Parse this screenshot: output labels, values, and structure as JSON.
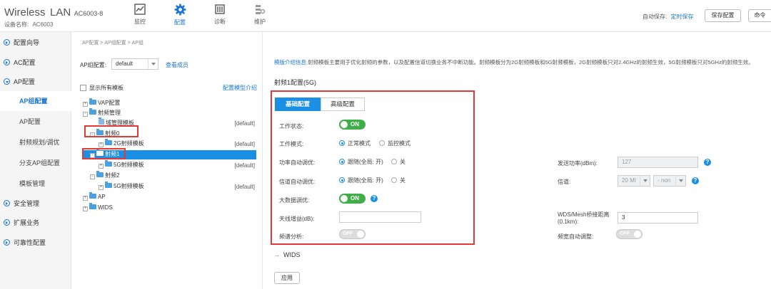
{
  "header": {
    "brand_wireless": "Wireless",
    "brand_lan": "LAN",
    "model": "AC6003-8",
    "device_label": "设备名称:",
    "device_name": "AC6003",
    "nav": [
      {
        "label": "监控",
        "icon": "monitor-chart-icon",
        "active": false
      },
      {
        "label": "配置",
        "icon": "gear-icon",
        "active": true
      },
      {
        "label": "诊断",
        "icon": "diagnose-tool-icon",
        "active": false
      },
      {
        "label": "维护",
        "icon": "maintenance-icon",
        "active": false
      }
    ],
    "autosave_label": "自动保存:",
    "autosave_link": "定时保存",
    "save_button": "保存配置",
    "cmd_button": "命令"
  },
  "sidebar": {
    "items": [
      {
        "label": "配置向导"
      },
      {
        "label": "AC配置"
      },
      {
        "label": "AP配置"
      }
    ],
    "subitems": [
      {
        "label": "AP组配置",
        "active": true
      },
      {
        "label": "AP配置",
        "active": false
      },
      {
        "label": "射频规划/调优",
        "active": false
      },
      {
        "label": "分支AP组配置",
        "active": false
      },
      {
        "label": "模板管理",
        "active": false
      }
    ],
    "bottom_items": [
      {
        "label": "安全管理"
      },
      {
        "label": "扩展业务"
      },
      {
        "label": "可靠性配置"
      }
    ]
  },
  "tree_panel": {
    "breadcrumb": "AP配置 > AP组配置 > AP组",
    "ap_group_label": "AP组配置:",
    "ap_group_value": "default",
    "view_members": "查看成员",
    "show_all_label": "显示所有模板",
    "model_intro": "配置模型介绍",
    "nodes": [
      {
        "label": "VAP配置",
        "pm": "+"
      },
      {
        "label": "射频管理",
        "pm": "-"
      },
      {
        "label": "域管理模板",
        "default": "[default]"
      },
      {
        "label": "射频0",
        "pm": "-"
      },
      {
        "label": "2G射频模板",
        "pm": "+",
        "default": "[default]"
      },
      {
        "label": "射频1",
        "pm": "-"
      },
      {
        "label": "5G射频模板",
        "pm": "+",
        "default": "[default]"
      },
      {
        "label": "射频2",
        "pm": "-"
      },
      {
        "label": "5G射频模板",
        "pm": "+",
        "default": "[default]"
      },
      {
        "label": "AP",
        "pm": "+"
      },
      {
        "label": "WIDS",
        "pm": "+"
      }
    ]
  },
  "main": {
    "info_key": "模版介绍信息:",
    "info_text": "射频模板主要用于优化射频的参数，以及配置信道切换业务不中断功能。射频模板分为2G射频模板和5G射频模板，2G射频模板只对2.4GHz的射频生效，5G射频模板只对5GHz的射频生效。",
    "radio_title": "射频1配置(5G)",
    "tabs": [
      {
        "label": "基础配置",
        "active": true
      },
      {
        "label": "高级配置",
        "active": false
      }
    ],
    "fields": {
      "work_status": "工作状态:",
      "work_mode": "工作模式:",
      "mode_normal": "正常模式",
      "mode_monitor": "监控模式",
      "power_auto": "功率自动调优:",
      "channel_auto": "信道自动调优:",
      "follow": "跟随(全局: 开)",
      "off_text": "关",
      "bigdata": "大数据调优:",
      "antenna_gain": "天线增益(dB):",
      "antenna_gain_value": "",
      "spectrum": "频谱分析:",
      "tx_power": "发送功率(dBm):",
      "tx_power_value": "127",
      "channel": "信道:",
      "channel_value": "20 MI",
      "channel_value2": "- non",
      "wds_distance": "WDS/Mesh桥接距离(0.1km):",
      "wds_distance_value": "3",
      "bw_auto": "频宽自动调整:"
    },
    "on_text": "ON",
    "off_toggle_text": "OFF",
    "wids_label": "WIDS",
    "apply_button": "应用"
  },
  "colors": {
    "accent": "#1a8fe3",
    "toggle_on": "#3fae49",
    "highlight_box": "#e53935"
  }
}
